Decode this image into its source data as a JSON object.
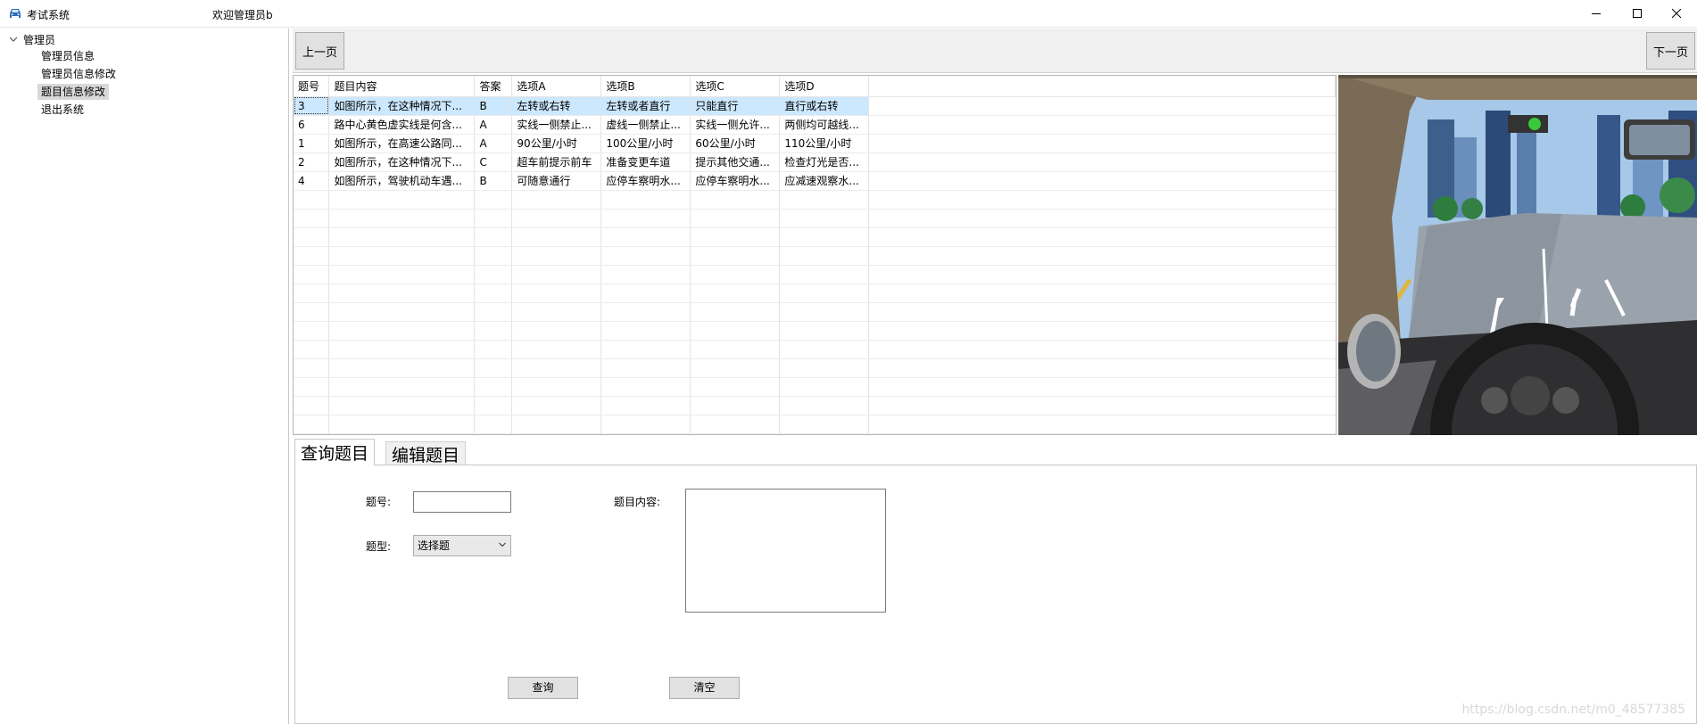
{
  "window": {
    "app_title": "考试系统",
    "welcome": "欢迎管理员b"
  },
  "tree": {
    "root": "管理员",
    "items": [
      "管理员信息",
      "管理员信息修改",
      "题目信息修改",
      "退出系统"
    ],
    "selected": "题目信息修改"
  },
  "nav": {
    "prev": "上一页",
    "next": "下一页"
  },
  "table": {
    "columns": [
      "题号",
      "题目内容",
      "答案",
      "选项A",
      "选项B",
      "选项C",
      "选项D"
    ],
    "rows": [
      [
        "3",
        "如图所示，在这种情况下...",
        "B",
        "左转或右转",
        "左转或者直行",
        "只能直行",
        "直行或右转"
      ],
      [
        "6",
        "路中心黄色虚实线是何含...",
        "A",
        "实线一侧禁止...",
        "虚线一侧禁止...",
        "实线一侧允许...",
        "两侧均可越线..."
      ],
      [
        "1",
        "如图所示，在高速公路同...",
        "A",
        "90公里/小时",
        "100公里/小时",
        "60公里/小时",
        "110公里/小时"
      ],
      [
        "2",
        "如图所示，在这种情况下...",
        "C",
        "超车前提示前车",
        "准备变更车道",
        "提示其他交通...",
        "检查灯光是否..."
      ],
      [
        "4",
        "如图所示，驾驶机动车遇...",
        "B",
        "可随意通行",
        "应停车察明水...",
        "应停车察明水...",
        "应减速观察水..."
      ]
    ],
    "selected_row": 0
  },
  "tabs": {
    "query": "查询题目",
    "edit": "编辑题目"
  },
  "form": {
    "id_label": "题号:",
    "id_value": "",
    "type_label": "题型:",
    "type_value": "选择题",
    "content_label": "题目内容:",
    "content_value": "",
    "query_button": "查询",
    "clear_button": "清空"
  },
  "watermark": "https://blog.csdn.net/m0_48577385"
}
